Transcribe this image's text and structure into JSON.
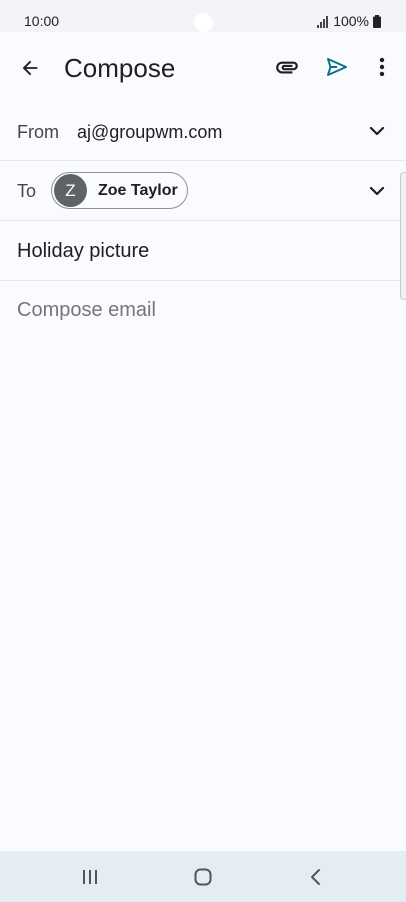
{
  "status_bar": {
    "time": "10:00",
    "battery": "100%",
    "icons": [
      "signal-icon",
      "battery-icon"
    ]
  },
  "app_bar": {
    "title": "Compose",
    "icons": [
      "back-arrow-icon",
      "paperclip-icon",
      "send-icon",
      "more-vert-icon"
    ]
  },
  "from": {
    "label": "From",
    "value": "aj@groupwm.com"
  },
  "to": {
    "label": "To",
    "recipients": [
      {
        "initial": "Z",
        "name": "Zoe Taylor"
      }
    ]
  },
  "subject": {
    "value": "Holiday picture"
  },
  "body": {
    "placeholder": "Compose email"
  },
  "nav_bar": {
    "icons": [
      "recent-apps-icon",
      "home-icon",
      "nav-back-icon"
    ]
  },
  "colors": {
    "accent_send": "#0b7285",
    "avatar_bg": "#5f6368",
    "nav_bar_bg": "#e4edf2"
  }
}
